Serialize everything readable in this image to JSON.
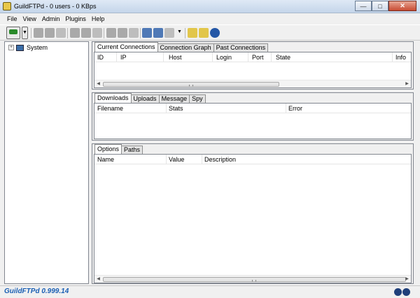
{
  "window": {
    "title": "GuildFTPd - 0 users - 0 KBps",
    "min_glyph": "—",
    "max_glyph": "□",
    "close_glyph": "✕"
  },
  "menu": [
    "File",
    "View",
    "Admin",
    "Plugins",
    "Help"
  ],
  "toolbar": {
    "dropdown_glyph": "▼"
  },
  "tree": {
    "expander": "+",
    "root_label": "System"
  },
  "connections": {
    "tabs": [
      "Current Connections",
      "Connection Graph",
      "Past Connections"
    ],
    "columns": [
      "ID",
      "IP",
      "Host",
      "Login",
      "Port",
      "State",
      "Info"
    ]
  },
  "transfers": {
    "tabs": [
      "Downloads",
      "Uploads",
      "Message",
      "Spy"
    ],
    "columns": [
      "Filename",
      "Stats",
      "Error"
    ]
  },
  "options": {
    "tabs": [
      "Options",
      "Paths"
    ],
    "columns": [
      "Name",
      "Value",
      "Description"
    ]
  },
  "scroll": {
    "left": "◀",
    "right": "▶"
  },
  "status": {
    "version": "GuildFTPd 0.999.14"
  }
}
